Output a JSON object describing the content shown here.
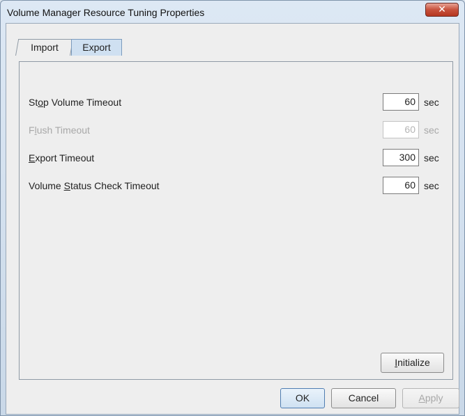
{
  "window": {
    "title": "Volume Manager Resource Tuning Properties",
    "close_icon": "close-icon"
  },
  "tabs": [
    {
      "label": "Import"
    },
    {
      "label": "Export"
    }
  ],
  "fields": [
    {
      "label_pre": "St",
      "label_mn": "o",
      "label_post": "p Volume Timeout",
      "value": "60",
      "unit": "sec",
      "enabled": true
    },
    {
      "label_pre": "F",
      "label_mn": "l",
      "label_post": "ush Timeout",
      "value": "60",
      "unit": "sec",
      "enabled": false
    },
    {
      "label_pre": "",
      "label_mn": "E",
      "label_post": "xport Timeout",
      "value": "300",
      "unit": "sec",
      "enabled": true
    },
    {
      "label_pre": "Volume ",
      "label_mn": "S",
      "label_post": "tatus Check Timeout",
      "value": "60",
      "unit": "sec",
      "enabled": true
    }
  ],
  "initialize": {
    "mn": "I",
    "rest": "nitialize"
  },
  "buttons": {
    "ok": "OK",
    "cancel": "Cancel",
    "apply_mn": "A",
    "apply_rest": "pply"
  }
}
